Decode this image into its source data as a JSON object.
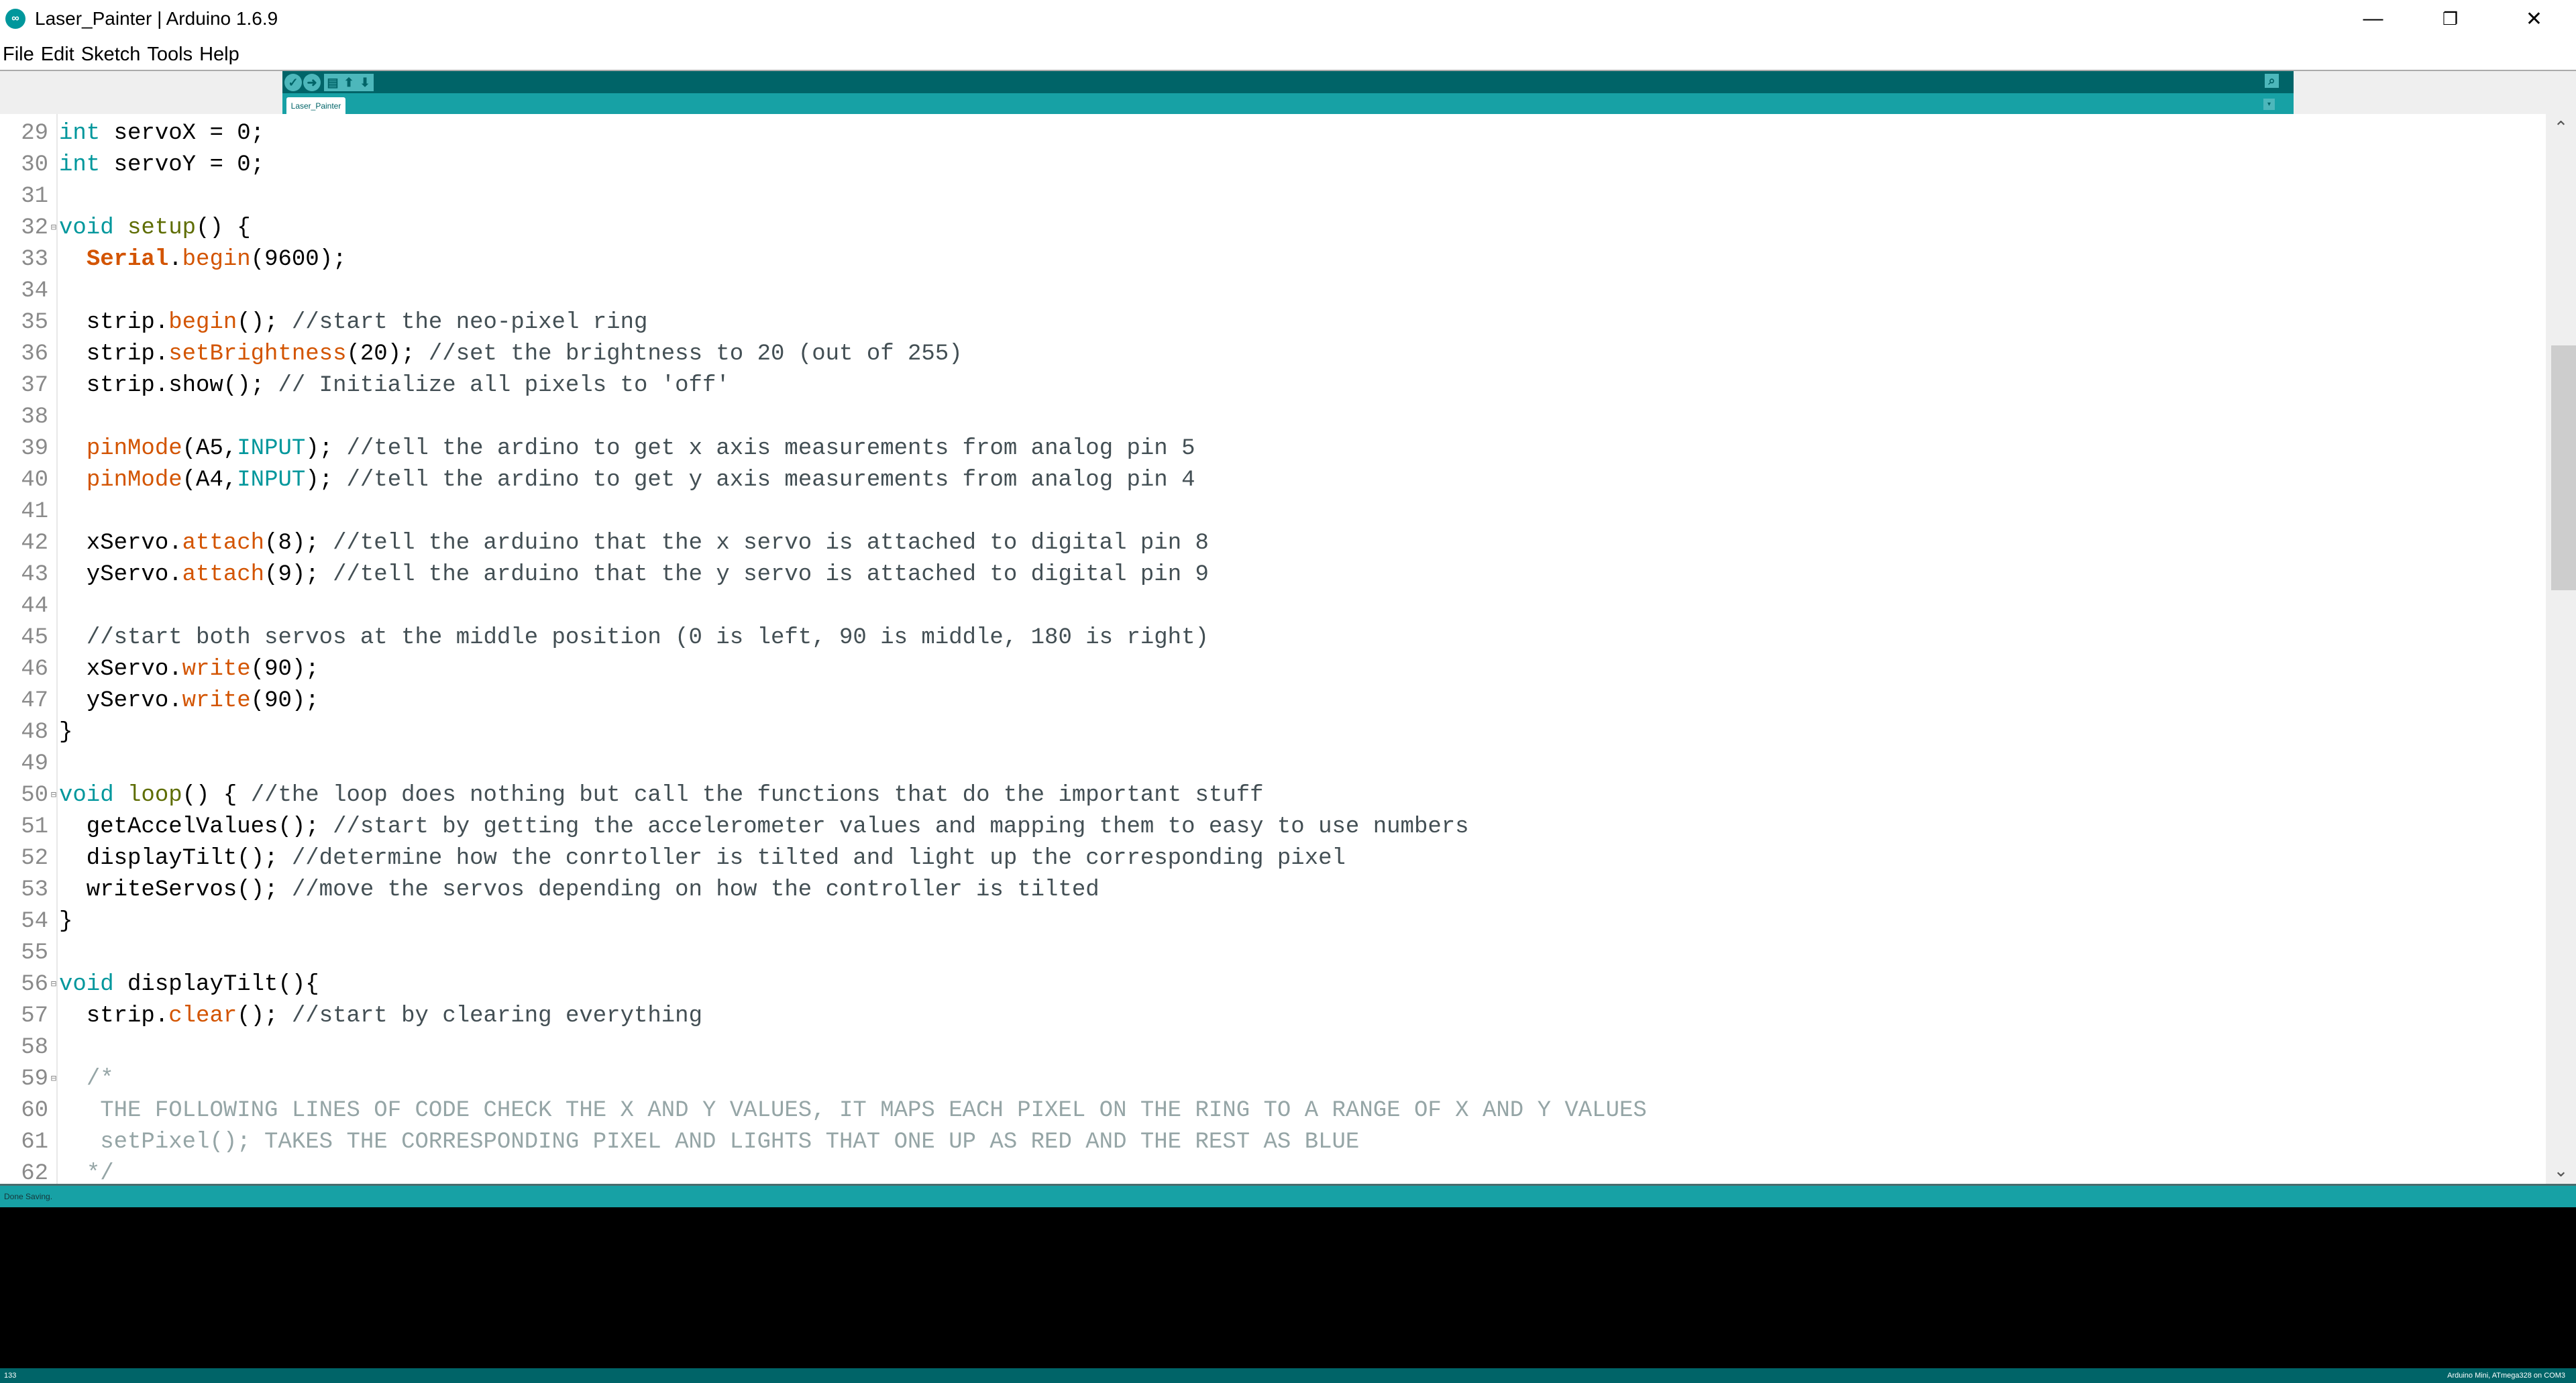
{
  "window": {
    "title": "Laser_Painter | Arduino 1.6.9",
    "minimize": "—",
    "restore": "❐",
    "close": "✕"
  },
  "menu": [
    "File",
    "Edit",
    "Sketch",
    "Tools",
    "Help"
  ],
  "toolbar": {
    "verify": "✓",
    "upload": "➜",
    "new": "▤",
    "open": "⬆",
    "save": "⬇",
    "serial_monitor": "⌕"
  },
  "tab": {
    "label": "Laser_Painter",
    "menu": "▾"
  },
  "colors": {
    "accent": "#00979c",
    "toolbar": "#006468",
    "tabrow": "#17a1a5",
    "function": "#d35400",
    "comment": "#434f54",
    "block_comment": "#95a5a6",
    "lifecycle": "#5e6d03"
  },
  "code": [
    {
      "n": "29",
      "t": [
        [
          "k",
          "int"
        ],
        [
          "p",
          " servoX = 0;"
        ]
      ]
    },
    {
      "n": "30",
      "t": [
        [
          "k",
          "int"
        ],
        [
          "p",
          " servoY = 0;"
        ]
      ]
    },
    {
      "n": "31",
      "t": []
    },
    {
      "n": "32",
      "fold": true,
      "t": [
        [
          "k",
          "void"
        ],
        [
          "p",
          " "
        ],
        [
          "s",
          "setup"
        ],
        [
          "p",
          "() {"
        ]
      ]
    },
    {
      "n": "33",
      "t": [
        [
          "p",
          "  "
        ],
        [
          "b",
          "Serial"
        ],
        [
          "p",
          "."
        ],
        [
          "f",
          "begin"
        ],
        [
          "p",
          "(9600);"
        ]
      ]
    },
    {
      "n": "34",
      "t": []
    },
    {
      "n": "35",
      "t": [
        [
          "p",
          "  strip."
        ],
        [
          "f",
          "begin"
        ],
        [
          "p",
          "(); "
        ],
        [
          "c",
          "//start the neo-pixel ring"
        ]
      ]
    },
    {
      "n": "36",
      "t": [
        [
          "p",
          "  strip."
        ],
        [
          "f",
          "setBrightness"
        ],
        [
          "p",
          "(20); "
        ],
        [
          "c",
          "//set the brightness to 20 (out of 255)"
        ]
      ]
    },
    {
      "n": "37",
      "t": [
        [
          "p",
          "  strip.show(); "
        ],
        [
          "c",
          "// Initialize all pixels to 'off'"
        ]
      ]
    },
    {
      "n": "38",
      "t": []
    },
    {
      "n": "39",
      "t": [
        [
          "p",
          "  "
        ],
        [
          "f",
          "pinMode"
        ],
        [
          "p",
          "(A5,"
        ],
        [
          "k",
          "INPUT"
        ],
        [
          "p",
          "); "
        ],
        [
          "c",
          "//tell the ardino to get x axis measurements from analog pin 5"
        ]
      ]
    },
    {
      "n": "40",
      "t": [
        [
          "p",
          "  "
        ],
        [
          "f",
          "pinMode"
        ],
        [
          "p",
          "(A4,"
        ],
        [
          "k",
          "INPUT"
        ],
        [
          "p",
          "); "
        ],
        [
          "c",
          "//tell the ardino to get y axis measurements from analog pin 4"
        ]
      ]
    },
    {
      "n": "41",
      "t": []
    },
    {
      "n": "42",
      "t": [
        [
          "p",
          "  xServo."
        ],
        [
          "f",
          "attach"
        ],
        [
          "p",
          "(8); "
        ],
        [
          "c",
          "//tell the arduino that the x servo is attached to digital pin 8"
        ]
      ]
    },
    {
      "n": "43",
      "t": [
        [
          "p",
          "  yServo."
        ],
        [
          "f",
          "attach"
        ],
        [
          "p",
          "(9); "
        ],
        [
          "c",
          "//tell the arduino that the y servo is attached to digital pin 9"
        ]
      ]
    },
    {
      "n": "44",
      "t": []
    },
    {
      "n": "45",
      "t": [
        [
          "p",
          "  "
        ],
        [
          "c",
          "//start both servos at the middle position (0 is left, 90 is middle, 180 is right)"
        ]
      ]
    },
    {
      "n": "46",
      "t": [
        [
          "p",
          "  xServo."
        ],
        [
          "f",
          "write"
        ],
        [
          "p",
          "(90);"
        ]
      ]
    },
    {
      "n": "47",
      "t": [
        [
          "p",
          "  yServo."
        ],
        [
          "f",
          "write"
        ],
        [
          "p",
          "(90);"
        ]
      ]
    },
    {
      "n": "48",
      "t": [
        [
          "p",
          "}"
        ]
      ]
    },
    {
      "n": "49",
      "t": []
    },
    {
      "n": "50",
      "fold": true,
      "t": [
        [
          "k",
          "void"
        ],
        [
          "p",
          " "
        ],
        [
          "s",
          "loop"
        ],
        [
          "p",
          "() { "
        ],
        [
          "c",
          "//the loop does nothing but call the functions that do the important stuff"
        ]
      ]
    },
    {
      "n": "51",
      "t": [
        [
          "p",
          "  getAccelValues(); "
        ],
        [
          "c",
          "//start by getting the accelerometer values and mapping them to easy to use numbers"
        ]
      ]
    },
    {
      "n": "52",
      "t": [
        [
          "p",
          "  displayTilt(); "
        ],
        [
          "c",
          "//determine how the conrtoller is tilted and light up the corresponding pixel"
        ]
      ]
    },
    {
      "n": "53",
      "t": [
        [
          "p",
          "  writeServos(); "
        ],
        [
          "c",
          "//move the servos depending on how the controller is tilted"
        ]
      ]
    },
    {
      "n": "54",
      "t": [
        [
          "p",
          "}"
        ]
      ]
    },
    {
      "n": "55",
      "t": []
    },
    {
      "n": "56",
      "fold": true,
      "t": [
        [
          "k",
          "void"
        ],
        [
          "p",
          " displayTilt(){"
        ]
      ]
    },
    {
      "n": "57",
      "t": [
        [
          "p",
          "  strip."
        ],
        [
          "f",
          "clear"
        ],
        [
          "p",
          "(); "
        ],
        [
          "c",
          "//start by clearing everything"
        ]
      ]
    },
    {
      "n": "58",
      "t": []
    },
    {
      "n": "59",
      "fold": true,
      "t": [
        [
          "p",
          "  "
        ],
        [
          "bc",
          "/*"
        ]
      ]
    },
    {
      "n": "60",
      "t": [
        [
          "p",
          "   "
        ],
        [
          "bc",
          "THE FOLLOWING LINES OF CODE CHECK THE X AND Y VALUES, IT MAPS EACH PIXEL ON THE RING TO A RANGE OF X AND Y VALUES"
        ]
      ]
    },
    {
      "n": "61",
      "t": [
        [
          "p",
          "   "
        ],
        [
          "bc",
          "setPixel(); TAKES THE CORRESPONDING PIXEL AND LIGHTS THAT ONE UP AS RED AND THE REST AS BLUE"
        ]
      ]
    },
    {
      "n": "62",
      "t": [
        [
          "p",
          "  "
        ],
        [
          "bc",
          "*/"
        ]
      ]
    }
  ],
  "status": {
    "message": "Done Saving.",
    "line": "133",
    "board": "Arduino Mini, ATmega328 on COM3"
  },
  "scroll": {
    "up": "⌃",
    "down": "⌄"
  }
}
